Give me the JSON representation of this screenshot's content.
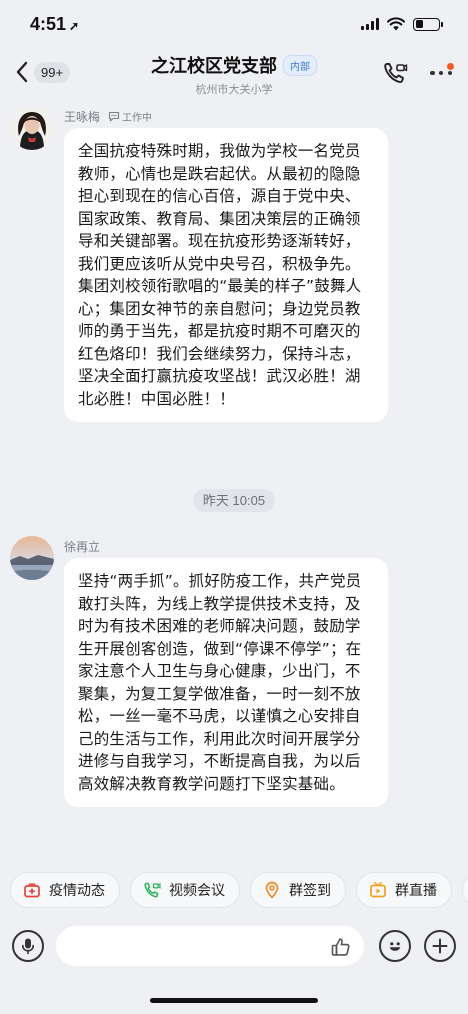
{
  "status_bar": {
    "time": "4:51",
    "location_glyph": "➚"
  },
  "header": {
    "back_badge": "99+",
    "title": "之江校区党支部",
    "tag": "内部",
    "subtitle": "杭州市大关小学",
    "icons": [
      "back-chevron-icon",
      "call-icon",
      "more-icon"
    ]
  },
  "messages": [
    {
      "sender": "王咏梅",
      "presence": "工作中",
      "text": "全国抗疫特殊时期，我做为学校一名党员教师，心情也是跌宕起伏。从最初的隐隐担心到现在的信心百倍，源自于党中央、国家政策、教育局、集团决策层的正确领导和关键部署。现在抗疫形势逐渐转好，我们更应该听从党中央号召，积极争先。集团刘校领衔歌唱的“最美的样子”鼓舞人心；集团女神节的亲自慰问；身边党员教师的勇于当先，都是抗疫时期不可磨灭的红色烙印！我们会继续努力，保持斗志，坚决全面打赢抗疫攻坚战！武汉必胜！湖北必胜！中国必胜！！"
    },
    {
      "sender": "徐再立",
      "text": "坚持“两手抓”。抓好防疫工作，共产党员敢打头阵，为线上教学提供技术支持，及时为有技术困难的老师解决问题，鼓励学生开展创客创造，做到“停课不停学”；在家注意个人卫生与身心健康，少出门，不聚集，为复工复学做准备，一时一刻不放松，一丝一毫不马虎，以谨慎之心安排自己的生活与工作，利用此次时间开展学分进修与自我学习，不断提高自我，为以后高效解决教育教学问题打下坚实基础。"
    }
  ],
  "timestamp": "昨天 10:05",
  "quick_actions": [
    {
      "label": "疫情动态",
      "icon": "first-aid-kit-icon",
      "color": "#e8413c"
    },
    {
      "label": "视频会议",
      "icon": "video-call-icon",
      "color": "#2bb35a"
    },
    {
      "label": "群签到",
      "icon": "location-pin-icon",
      "color": "#f08a24"
    },
    {
      "label": "群直播",
      "icon": "live-tv-icon",
      "color": "#f0a020"
    }
  ],
  "input_bar": {
    "placeholder": "",
    "icons": [
      "microphone-icon",
      "thumbs-up-icon",
      "emoji-icon",
      "plus-icon"
    ]
  },
  "colors": {
    "background": "#eff0f4",
    "bubble": "#ffffff",
    "accent_blue": "#3a7bd5",
    "notification_dot": "#f15a22"
  }
}
